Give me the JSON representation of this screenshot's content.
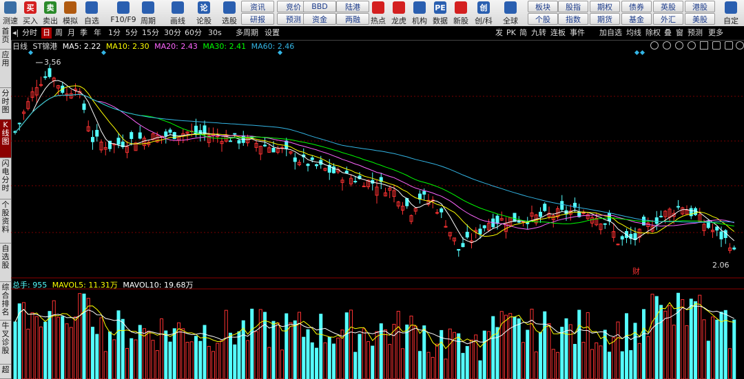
{
  "toolbar": {
    "items": [
      {
        "label": "测速",
        "icon": "speed-icon",
        "color": "#3a6ea5"
      },
      {
        "label": "买入",
        "icon_text": "买",
        "color": "#d42020"
      },
      {
        "label": "卖出",
        "icon_text": "卖",
        "color": "#2a8a2a"
      },
      {
        "label": "模拟",
        "icon": "hammer-icon",
        "color": "#b05a10"
      },
      {
        "label": "自选",
        "icon": "star-icon",
        "color": "#2a5fb0"
      },
      {
        "label": "F10/F9",
        "icon": "f10-icon",
        "color": "#2a5fb0"
      },
      {
        "label": "周期",
        "icon": "clock-icon",
        "color": "#2a5fb0"
      },
      {
        "label": "画线",
        "icon": "pen-icon",
        "color": "#2a5fb0"
      },
      {
        "label": "论股",
        "icon_text": "论",
        "color": "#2a5fb0"
      },
      {
        "label": "选股",
        "icon": "magnifier-icon",
        "color": "#2a5fb0"
      }
    ],
    "buttons_row1": [
      "资讯",
      "竞价",
      "BBD",
      "陆港"
    ],
    "buttons_row2": [
      "研报",
      "预测",
      "资金",
      "两融"
    ],
    "items2": [
      {
        "label": "热点",
        "icon": "fire-icon",
        "color": "#d42020"
      },
      {
        "label": "龙虎",
        "icon": "dragon-icon",
        "color": "#d42020"
      },
      {
        "label": "机构",
        "icon": "bank-icon",
        "color": "#2a5fb0"
      },
      {
        "label": "数据",
        "icon_text": "PE",
        "color": "#2a5fb0"
      },
      {
        "label": "新股",
        "icon": "newstock-icon",
        "color": "#d42020"
      },
      {
        "label": "创/科",
        "icon_text": "创",
        "color": "#2a5fb0"
      },
      {
        "label": "全球",
        "icon": "globe-icon",
        "color": "#2a5fb0"
      }
    ],
    "buttons2_row1": [
      "板块",
      "股指",
      "期权",
      "债券",
      "英股",
      "港股"
    ],
    "buttons2_row2": [
      "个股",
      "指数",
      "期货",
      "基金",
      "外汇",
      "美股"
    ],
    "custom_label": "自定"
  },
  "sidebar": {
    "items": [
      "首页",
      "应用",
      "分时图",
      "K线图",
      "闪电分时",
      "个股资料",
      "自选股",
      "综合排名",
      "牛叉诊股",
      "超"
    ]
  },
  "periodbar": {
    "items": [
      "分时",
      "日",
      "周",
      "月",
      "季",
      "年",
      "1分",
      "5分",
      "15分",
      "30分",
      "60分",
      "30s",
      "多周期",
      "设置"
    ],
    "selected": "日",
    "right_items": [
      "发",
      "PK",
      "简",
      "九转",
      "连板",
      "事件",
      "加自选",
      "均线",
      "除权",
      "叠",
      "窗",
      "预测",
      "更多"
    ]
  },
  "kline": {
    "period_label": "日线",
    "stock_name": "ST锦港",
    "ma": [
      {
        "label": "MA5: 2.22",
        "color": "#ffffff"
      },
      {
        "label": "MA10: 2.30",
        "color": "#ffff00"
      },
      {
        "label": "MA20: 2.43",
        "color": "#ff66ff"
      },
      {
        "label": "MA30: 2.41",
        "color": "#00ff00"
      },
      {
        "label": "MA60: 2.46",
        "color": "#33b5e5"
      }
    ],
    "high_label": "3.56",
    "low_label": "2.06",
    "event_marker": "财"
  },
  "volume": {
    "total_label": "总手: 955",
    "mavol5": "MAVOL5: 11.31万",
    "mavol10": "MAVOL10: 19.68万"
  },
  "colors": {
    "up": "#ff3232",
    "down": "#54ffff",
    "background": "#000000",
    "grid": "#8b0000"
  }
}
